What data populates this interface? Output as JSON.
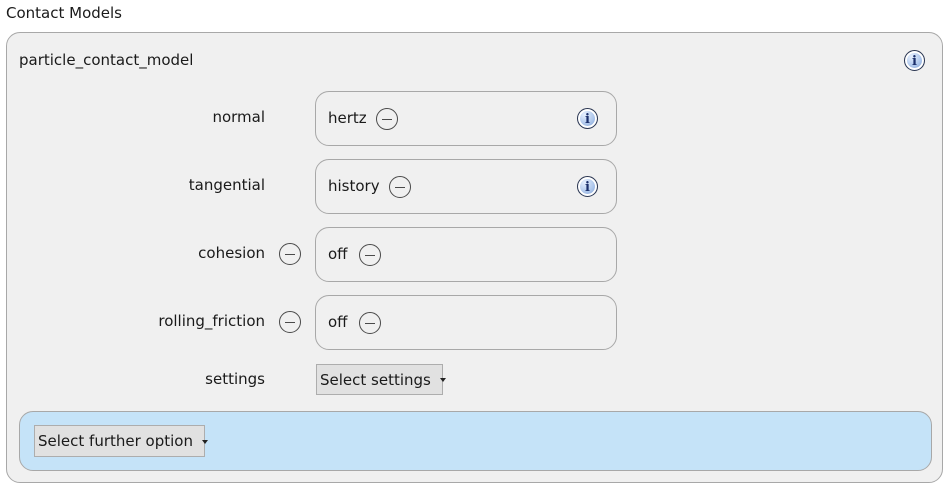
{
  "section": {
    "title": "Contact Models"
  },
  "panel": {
    "title": "particle_contact_model",
    "info_icon": "info-icon"
  },
  "rows": [
    {
      "label": "normal",
      "value": "hertz",
      "removable": false,
      "has_info": true
    },
    {
      "label": "tangential",
      "value": "history",
      "removable": false,
      "has_info": true
    },
    {
      "label": "cohesion",
      "value": "off",
      "removable": true,
      "has_info": false
    },
    {
      "label": "rolling_friction",
      "value": "off",
      "removable": true,
      "has_info": false
    }
  ],
  "settings": {
    "label": "settings",
    "dropdown": "Select settings"
  },
  "further": {
    "dropdown": "Select further option"
  },
  "colors": {
    "panel_bg": "#f0f0f0",
    "border": "#a8a8a8",
    "further_bg": "#c5e3f8",
    "dropdown_bg": "#e1e1e1"
  }
}
